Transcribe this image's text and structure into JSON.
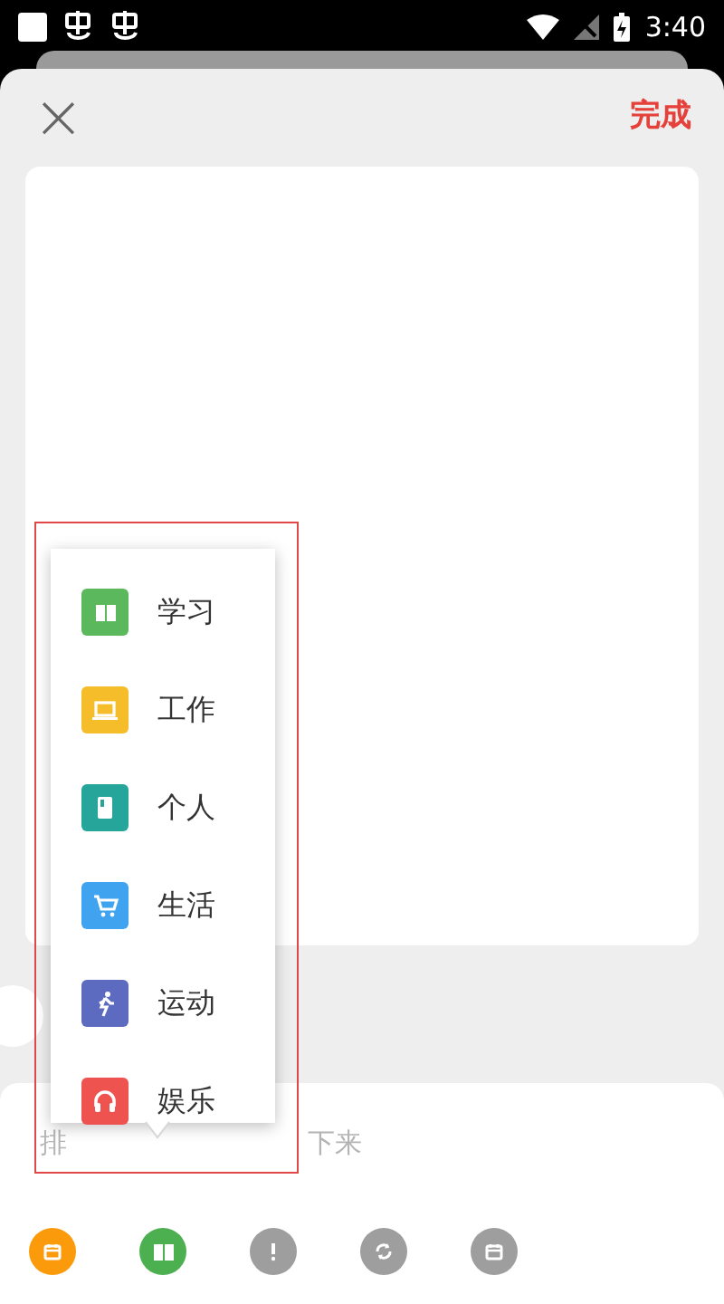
{
  "status_bar": {
    "time": "3:40"
  },
  "header": {
    "close": "×",
    "done": "完成"
  },
  "hint_fragments": [
    "排",
    "下来"
  ],
  "category_menu": [
    {
      "label": "学习",
      "kind": "book",
      "color": "#5cb85c"
    },
    {
      "label": "工作",
      "kind": "laptop",
      "color": "#f6bd2b"
    },
    {
      "label": "个人",
      "kind": "note",
      "color": "#26a69a"
    },
    {
      "label": "生活",
      "kind": "cart",
      "color": "#3fa3f0"
    },
    {
      "label": "运动",
      "kind": "run",
      "color": "#5c6bc0"
    },
    {
      "label": "娱乐",
      "kind": "headphones",
      "color": "#ef5350"
    }
  ],
  "toolbar": [
    {
      "kind": "calendar",
      "color": "#fb9b0c"
    },
    {
      "kind": "book",
      "color": "#4caf50"
    },
    {
      "kind": "alert",
      "color": "#9e9e9e"
    },
    {
      "kind": "refresh",
      "color": "#9e9e9e"
    },
    {
      "kind": "calendar",
      "color": "#9e9e9e"
    }
  ]
}
